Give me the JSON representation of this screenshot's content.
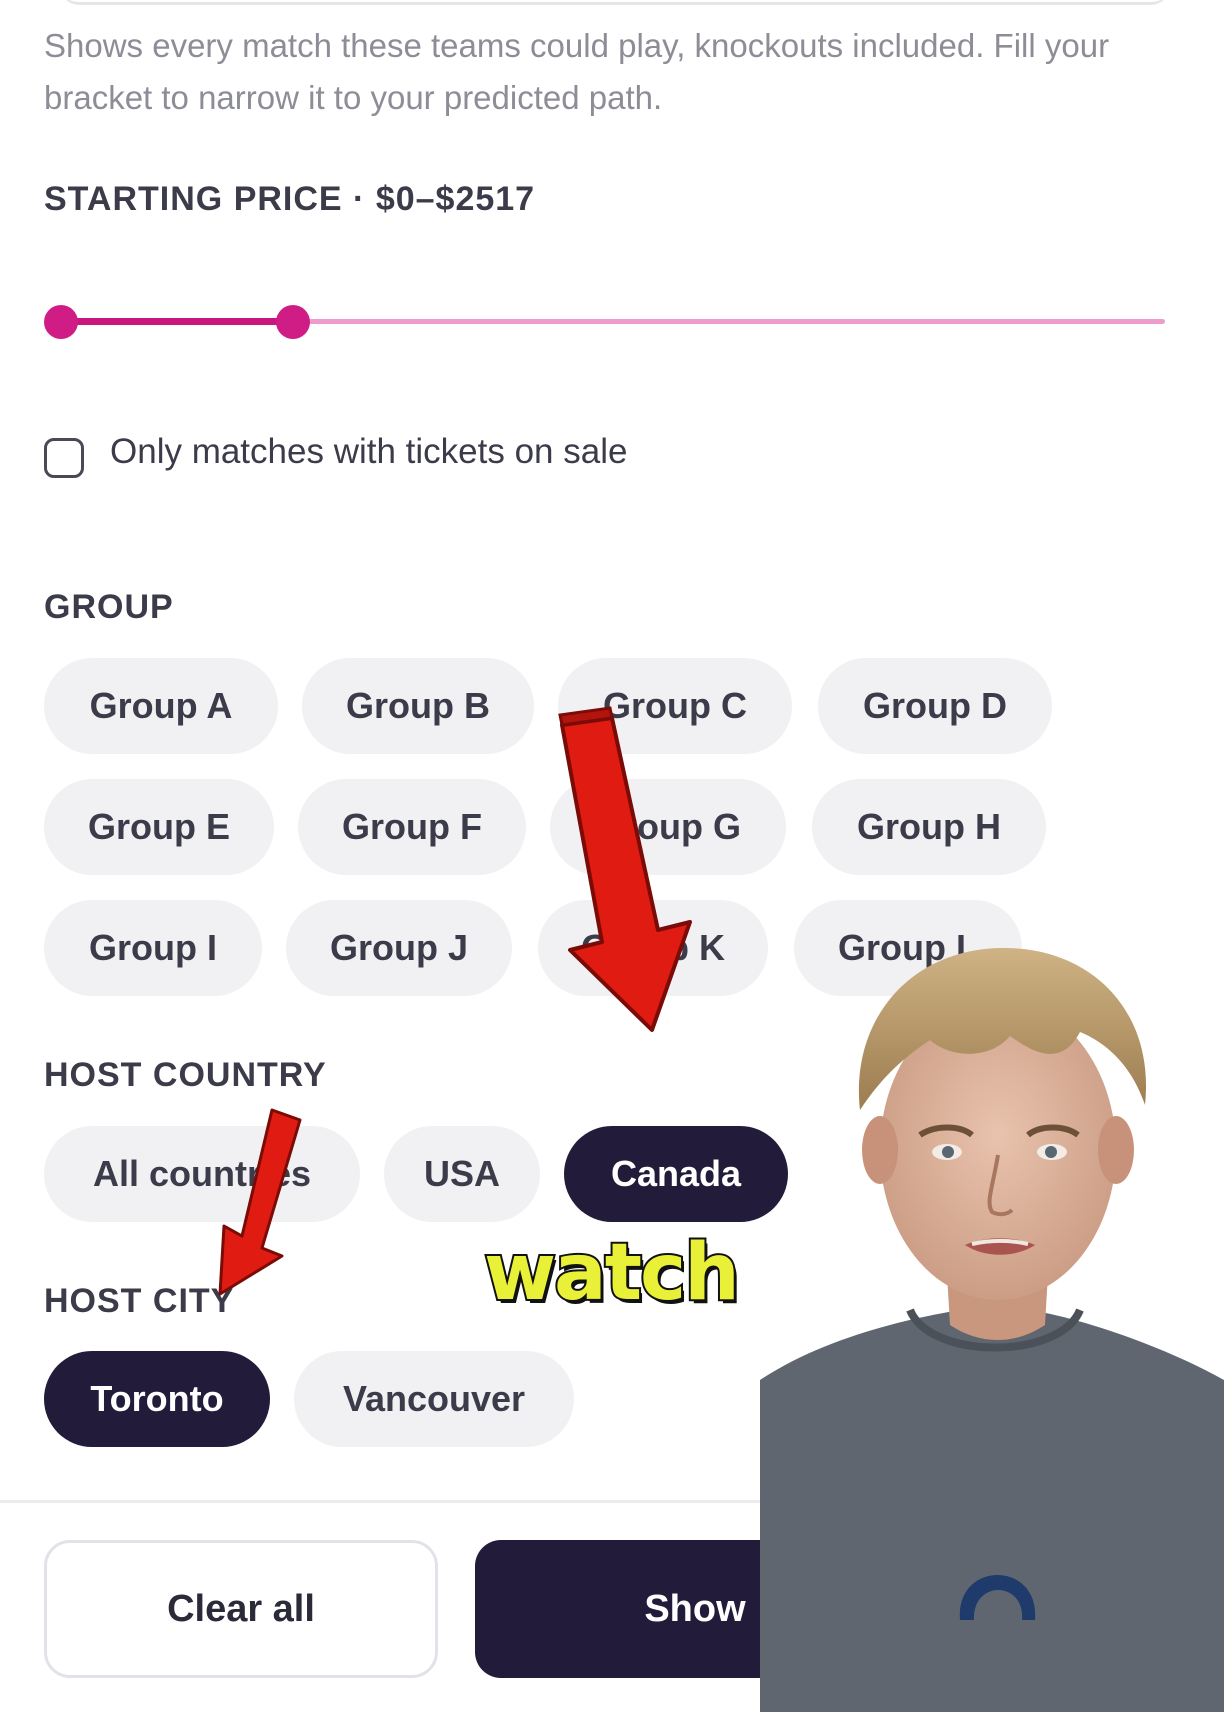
{
  "filters": {
    "helper_text": "Shows every match these teams could play, knockouts included. Fill your bracket to narrow it to your predicted path.",
    "price": {
      "label": "STARTING PRICE · $0–$2517",
      "min": 0,
      "max": 2517,
      "selected_low_fraction": 0,
      "selected_high_fraction": 0.21
    },
    "on_sale_checkbox": {
      "label": "Only matches with tickets on sale",
      "checked": false
    },
    "group": {
      "label": "GROUP",
      "chips": [
        "Group A",
        "Group B",
        "Group C",
        "Group D",
        "Group E",
        "Group F",
        "Group G",
        "Group H",
        "Group I",
        "Group J",
        "Group K",
        "Group L"
      ]
    },
    "host_country": {
      "label": "HOST COUNTRY",
      "chips": [
        "All countries",
        "USA",
        "Canada"
      ],
      "selected": "Canada"
    },
    "host_city": {
      "label": "HOST CITY",
      "chips": [
        "Toronto",
        "Vancouver"
      ],
      "selected": "Toronto"
    }
  },
  "footer": {
    "clear_label": "Clear all",
    "show_label": "Show"
  },
  "overlay": {
    "caption": "watch"
  },
  "colors": {
    "accent": "#c8177e",
    "track": "#ee9ccc",
    "chip_bg": "#f1f1f4",
    "chip_active": "#221c3a",
    "arrow": "#e01b12"
  }
}
